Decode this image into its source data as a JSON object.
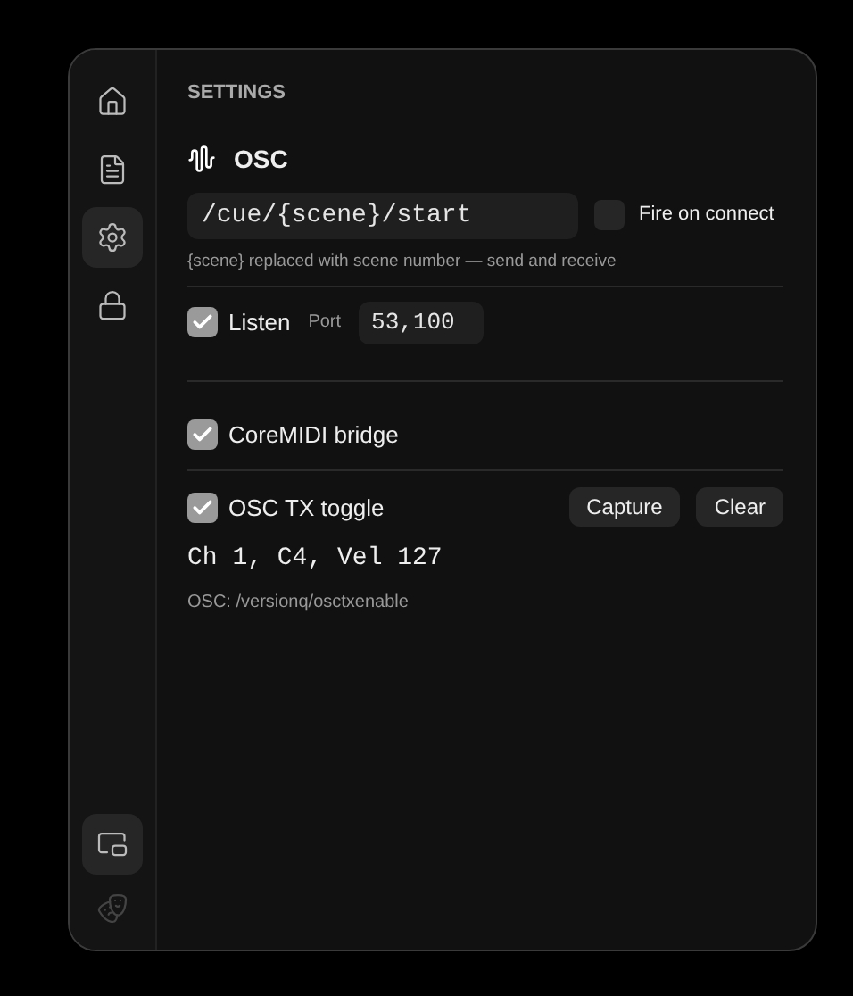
{
  "sidebar": {
    "items": [
      {
        "kind": "home",
        "selected": false
      },
      {
        "kind": "document",
        "selected": false
      },
      {
        "kind": "settings",
        "selected": true
      },
      {
        "kind": "lock",
        "selected": false
      }
    ],
    "bottom_items": [
      {
        "kind": "window",
        "selected": true
      },
      {
        "kind": "masks",
        "selected": false
      }
    ]
  },
  "heading": "SETTINGS",
  "osc": {
    "title": "OSC",
    "address": "/cue/{scene}/start",
    "fire_on_connect": {
      "label": "Fire on connect",
      "checked": false
    },
    "hint": "{scene} replaced with scene number — send and receive",
    "listen": {
      "label": "Listen",
      "checked": true
    },
    "port_label": "Port",
    "port": "53,100"
  },
  "coremidi": {
    "label": "CoreMIDI bridge",
    "checked": true
  },
  "osc_tx": {
    "label": "OSC TX toggle",
    "checked": true,
    "buttons": [
      "Capture",
      "Clear"
    ],
    "binding": "Ch 1, C4, Vel 127",
    "path": "OSC: /versionq/osctxenable"
  }
}
